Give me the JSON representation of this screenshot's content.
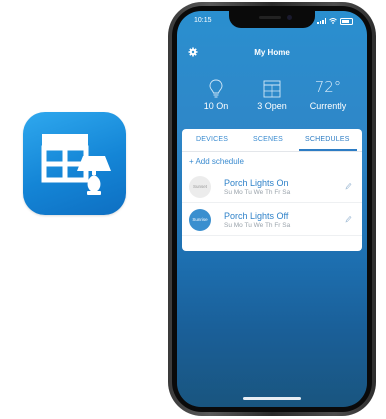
{
  "status_bar": {
    "time": "10:15"
  },
  "header": {
    "title": "My Home"
  },
  "stats": {
    "lights": {
      "label": "10 On",
      "icon": "lightbulb-icon"
    },
    "shades": {
      "label": "3 Open",
      "icon": "window-shade-icon"
    },
    "temperature": {
      "value": "72°",
      "label": "Currently"
    }
  },
  "tabs": [
    {
      "label": "DEVICES"
    },
    {
      "label": "SCENES"
    },
    {
      "label": "SCHEDULES",
      "active": true
    }
  ],
  "add_schedule_label": "+ Add schedule",
  "schedules": [
    {
      "badge": "Sunset",
      "title": "Porch Lights On",
      "days": "Su Mo Tu We Th Fr Sa"
    },
    {
      "badge": "Sunrise",
      "title": "Porch Lights Off",
      "days": "Su Mo Tu We Th Fr Sa"
    }
  ],
  "colors": {
    "accent": "#2c7cc4",
    "app_icon_blue": "#1b8ee0",
    "screen_background": "#2a8fcf",
    "sunrise_badge": "#3a8fcf"
  }
}
